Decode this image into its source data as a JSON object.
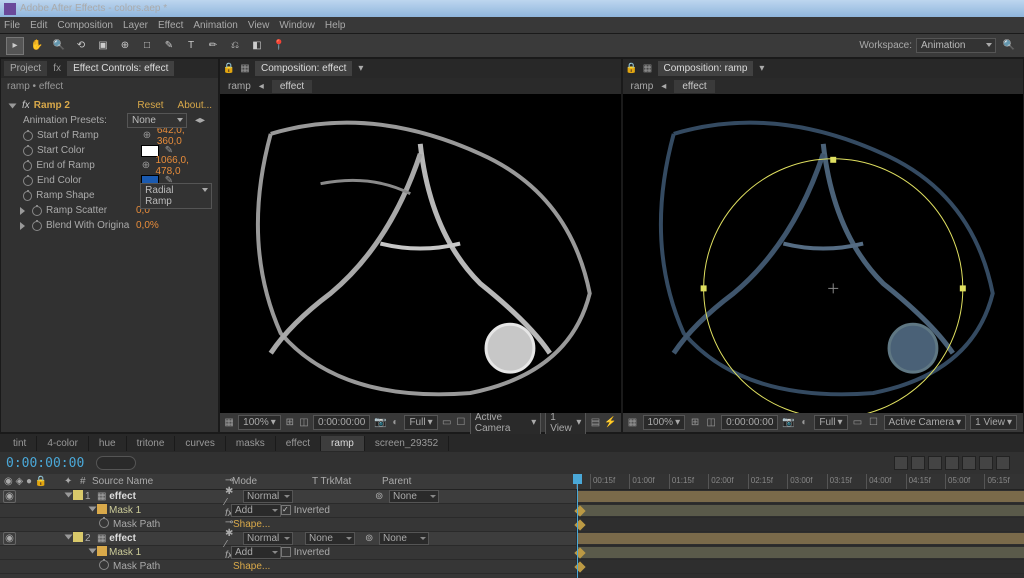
{
  "title": "Adobe After Effects - colors.aep *",
  "menu": [
    "File",
    "Edit",
    "Composition",
    "Layer",
    "Effect",
    "Animation",
    "View",
    "Window",
    "Help"
  ],
  "workspace": {
    "label": "Workspace:",
    "value": "Animation"
  },
  "left_panel": {
    "tabs": [
      "Project",
      "Effect Controls: effect"
    ],
    "active_tab": 1,
    "breadcrumb": "ramp • effect",
    "effect_name": "Ramp 2",
    "reset": "Reset",
    "about": "About...",
    "presets_label": "Animation Presets:",
    "presets_value": "None",
    "props": [
      {
        "label": "Start of Ramp",
        "value": "642,0, 360,0",
        "type": "point"
      },
      {
        "label": "Start Color",
        "type": "color",
        "color": "#ffffff"
      },
      {
        "label": "End of Ramp",
        "value": "1066,0, 478,0",
        "type": "point"
      },
      {
        "label": "End Color",
        "type": "color",
        "color": "#1a5ab0"
      },
      {
        "label": "Ramp Shape",
        "value": "Radial Ramp",
        "type": "dropdown"
      },
      {
        "label": "Ramp Scatter",
        "value": "0,0",
        "type": "num"
      },
      {
        "label": "Blend With Origina",
        "value": "0,0%",
        "type": "num",
        "expand": true
      }
    ]
  },
  "viewers": [
    {
      "tab": "Composition: effect",
      "crumbs": [
        "ramp",
        "effect"
      ],
      "active_crumb": 1,
      "mag": "100%",
      "res": "Full",
      "time": "0:00:00:00",
      "camera": "Active Camera",
      "view": "1 View",
      "mask": false
    },
    {
      "tab": "Composition: ramp",
      "crumbs": [
        "ramp",
        "effect"
      ],
      "active_crumb": 1,
      "mag": "100%",
      "res": "Full",
      "time": "0:00:00:00",
      "camera": "Active Camera",
      "view": "1 View",
      "mask": true
    }
  ],
  "timeline": {
    "tabs": [
      "tint",
      "4-color",
      "hue",
      "tritone",
      "curves",
      "masks",
      "effect",
      "ramp",
      "screen_29352"
    ],
    "active_tab": "ramp",
    "timecode": "0:00:00:00",
    "ruler": [
      "00:15f",
      "01:00f",
      "01:15f",
      "02:00f",
      "02:15f",
      "03:00f",
      "03:15f",
      "04:00f",
      "04:15f",
      "05:00f",
      "05:15f"
    ],
    "cols": {
      "source": "Source Name",
      "mode": "Mode",
      "trkmat": "T  TrkMat",
      "parent": "Parent"
    },
    "layers": [
      {
        "num": "1",
        "name": "effect",
        "mode": "Normal",
        "parent": "None",
        "mask": "Mask 1",
        "mask_mode": "Add",
        "inverted": true,
        "shape": "Shape...",
        "path": "Mask Path"
      },
      {
        "num": "2",
        "name": "effect",
        "mode": "Normal",
        "trkmat": "None",
        "parent": "None",
        "mask": "Mask 1",
        "mask_mode": "Add",
        "inverted": false,
        "shape": "Shape...",
        "path": "Mask Path"
      }
    ],
    "inverted_label": "Inverted"
  }
}
